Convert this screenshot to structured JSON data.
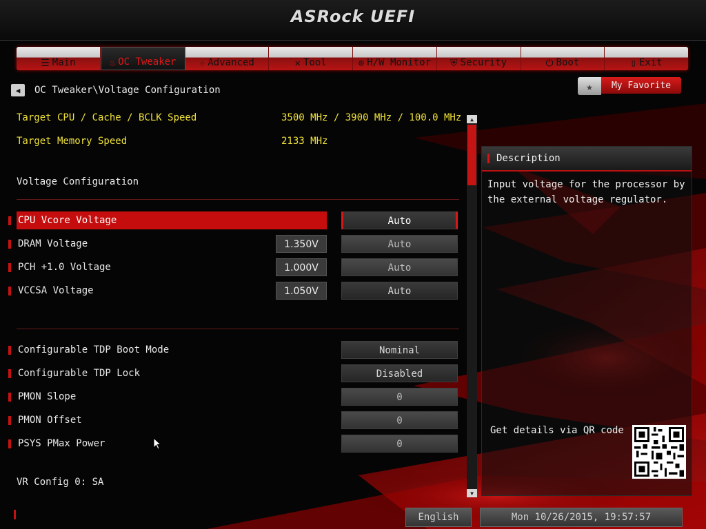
{
  "app": {
    "logo": "ASRock UEFI"
  },
  "nav": {
    "items": [
      {
        "label": "Main",
        "icon": "list-icon"
      },
      {
        "label": "OC Tweaker",
        "icon": "flame-icon",
        "active": true
      },
      {
        "label": "Advanced",
        "icon": "star-icon"
      },
      {
        "label": "Tool",
        "icon": "tools-icon"
      },
      {
        "label": "H/W Monitor",
        "icon": "globe-icon"
      },
      {
        "label": "Security",
        "icon": "shield-icon"
      },
      {
        "label": "Boot",
        "icon": "power-icon"
      },
      {
        "label": "Exit",
        "icon": "door-icon"
      }
    ]
  },
  "breadcrumb": {
    "path": "OC Tweaker\\Voltage Configuration"
  },
  "favorite": {
    "label": "My Favorite"
  },
  "info": {
    "cpu_label": "Target CPU / Cache / BCLK Speed",
    "cpu_value": "3500 MHz / 3900 MHz / 100.0 MHz",
    "mem_label": "Target Memory Speed",
    "mem_value": "2133 MHz"
  },
  "sections": {
    "voltage": "Voltage Configuration",
    "vr_config": "VR Config 0: SA"
  },
  "voltage_rows": [
    {
      "label": "CPU Vcore Voltage",
      "current": "",
      "value": "Auto",
      "selected": true
    },
    {
      "label": "DRAM Voltage",
      "current": "1.350V",
      "value": "Auto"
    },
    {
      "label": "PCH +1.0 Voltage",
      "current": "1.000V",
      "value": "Auto"
    },
    {
      "label": "VCCSA Voltage",
      "current": "1.050V",
      "value": "Auto"
    }
  ],
  "tdp_rows": [
    {
      "label": "Configurable TDP Boot Mode",
      "value": "Nominal"
    },
    {
      "label": "Configurable TDP Lock",
      "value": "Disabled"
    },
    {
      "label": "PMON Slope",
      "value": "0"
    },
    {
      "label": "PMON Offset",
      "value": "0"
    },
    {
      "label": "PSYS PMax Power",
      "value": "0"
    }
  ],
  "description": {
    "title": "Description",
    "text": "Input voltage for the processor by the external voltage regulator.",
    "qr_label": "Get details via QR code"
  },
  "footer": {
    "language": "English",
    "datetime": "Mon 10/26/2015, 19:57:57"
  },
  "colors": {
    "accent": "#c50d0d",
    "info_text": "#f0e23a"
  }
}
